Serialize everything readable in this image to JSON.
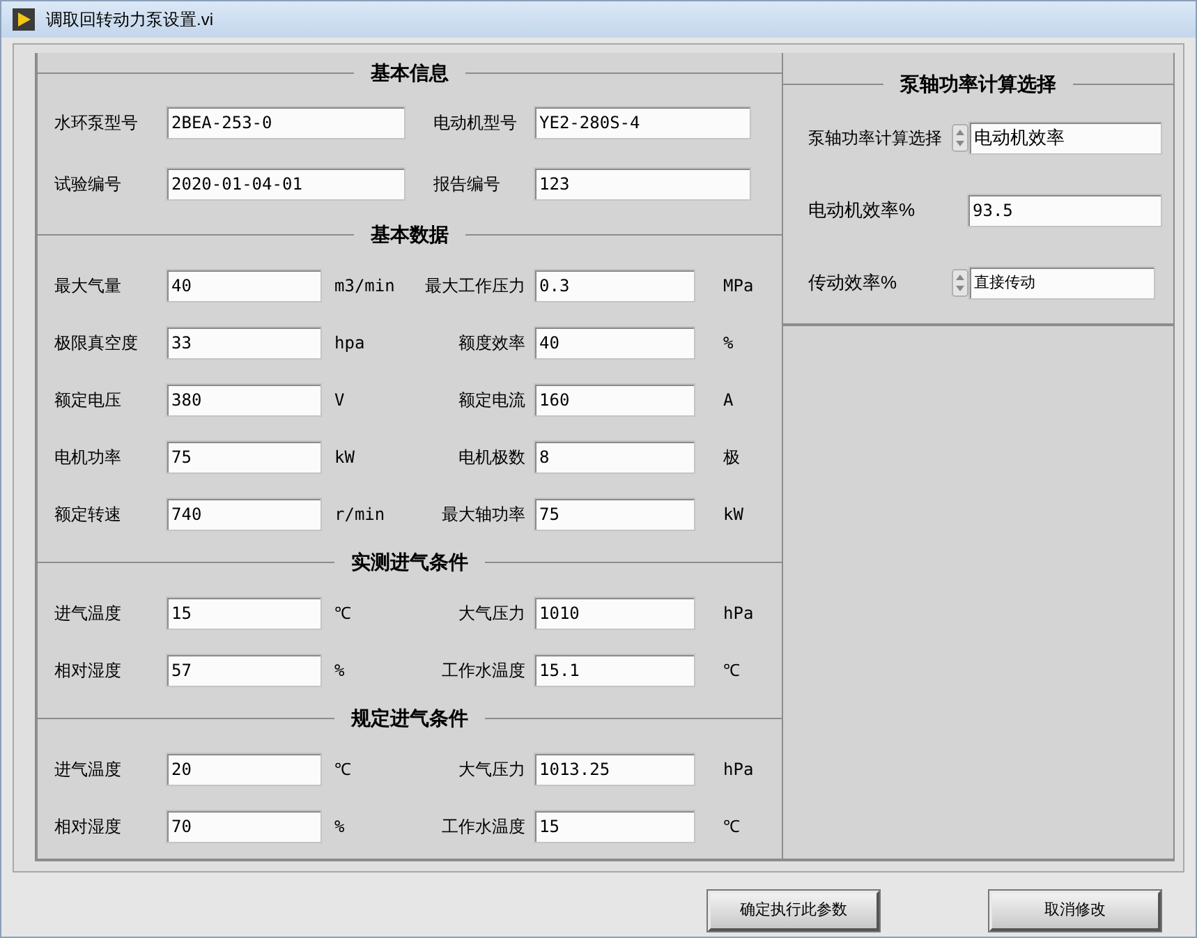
{
  "window": {
    "title": "调取回转动力泵设置.vi"
  },
  "sections": [
    {
      "title": "基本信息",
      "kind": "wide",
      "rows": [
        {
          "left": {
            "label": "水环泵型号",
            "value": "2BEA-253-0"
          },
          "right": {
            "label": "电动机型号",
            "value": "YE2-280S-4"
          }
        },
        {
          "left": {
            "label": "试验编号",
            "value": "2020-01-04-01"
          },
          "right": {
            "label": "报告编号",
            "value": "123"
          }
        }
      ]
    },
    {
      "title": "基本数据",
      "kind": "units",
      "rows": [
        {
          "left": {
            "label": "最大气量",
            "value": "40",
            "unit": "m3/min"
          },
          "right": {
            "label": "最大工作压力",
            "value": "0.3",
            "unit": "MPa"
          }
        },
        {
          "left": {
            "label": "极限真空度",
            "value": "33",
            "unit": "hpa"
          },
          "right": {
            "label": "额度效率",
            "value": "40",
            "unit": "%"
          }
        },
        {
          "left": {
            "label": "额定电压",
            "value": "380",
            "unit": "V"
          },
          "right": {
            "label": "额定电流",
            "value": "160",
            "unit": "A"
          }
        },
        {
          "left": {
            "label": "电机功率",
            "value": "75",
            "unit": "kW"
          },
          "right": {
            "label": "电机极数",
            "value": "8",
            "unit": "极"
          }
        },
        {
          "left": {
            "label": "额定转速",
            "value": "740",
            "unit": "r/min"
          },
          "right": {
            "label": "最大轴功率",
            "value": "75",
            "unit": "kW"
          }
        }
      ]
    },
    {
      "title": "实测进气条件",
      "kind": "units",
      "rows": [
        {
          "left": {
            "label": "进气温度",
            "value": "15",
            "unit": "℃"
          },
          "right": {
            "label": "大气压力",
            "value": "1010",
            "unit": "hPa"
          }
        },
        {
          "left": {
            "label": "相对湿度",
            "value": "57",
            "unit": "%"
          },
          "right": {
            "label": "工作水温度",
            "value": "15.1",
            "unit": "℃"
          }
        }
      ]
    },
    {
      "title": "规定进气条件",
      "kind": "units",
      "rows": [
        {
          "left": {
            "label": "进气温度",
            "value": "20",
            "unit": "℃"
          },
          "right": {
            "label": "大气压力",
            "value": "1013.25",
            "unit": "hPa"
          }
        },
        {
          "left": {
            "label": "相对湿度",
            "value": "70",
            "unit": "%"
          },
          "right": {
            "label": "工作水温度",
            "value": "15",
            "unit": "℃"
          }
        }
      ]
    }
  ],
  "pump_power": {
    "title": "泵轴功率计算选择",
    "items": [
      {
        "kind": "ring",
        "label": "泵轴功率计算选择",
        "value": "电动机效率"
      },
      {
        "kind": "number",
        "label": "电动机效率%",
        "value": "93.5"
      },
      {
        "kind": "ring_small",
        "label": "传动效率%",
        "value": "直接传动"
      }
    ]
  },
  "buttons": [
    "确定执行此参数",
    "取消修改"
  ]
}
